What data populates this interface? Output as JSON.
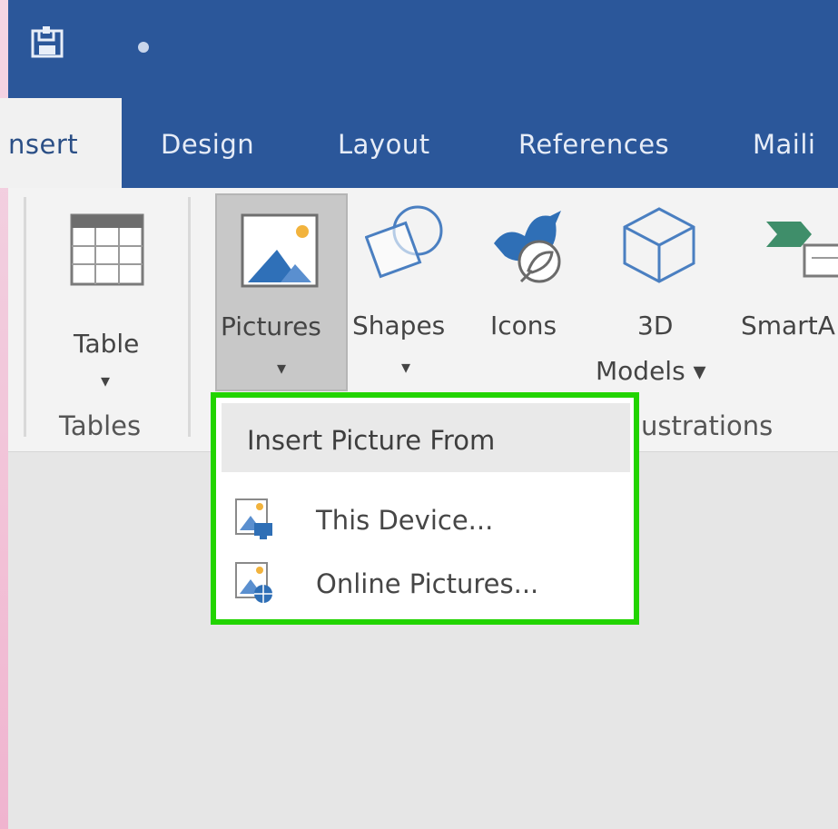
{
  "window": {
    "qat_icons": [
      "save-icon",
      "customize-dot-icon"
    ]
  },
  "tabs": [
    {
      "label": "nsert",
      "active": true
    },
    {
      "label": "Design",
      "active": false
    },
    {
      "label": "Layout",
      "active": false
    },
    {
      "label": "References",
      "active": false
    },
    {
      "label": "Maili",
      "active": false
    }
  ],
  "ribbon": {
    "table": {
      "label": "Table",
      "arrow": "▾",
      "icon": "table-icon"
    },
    "pictures": {
      "label": "Pictures",
      "arrow": "▾",
      "icon": "picture-icon"
    },
    "shapes": {
      "label": "Shapes",
      "arrow": "▾",
      "icon": "shapes-icon"
    },
    "icons": {
      "label": "Icons",
      "icon": "icons-icon"
    },
    "models3d": {
      "label_line1": "3D",
      "label_line2": "Models ▾",
      "icon": "cube-icon"
    },
    "smartart": {
      "label": "SmartA",
      "icon": "smartart-icon"
    },
    "groups": {
      "tables": "Tables",
      "illustrations": "ustrations"
    }
  },
  "dropdown": {
    "header": "Insert Picture From",
    "items": [
      {
        "label": "This Device...",
        "icon": "device-picture-icon"
      },
      {
        "label": "Online Pictures...",
        "icon": "online-picture-icon"
      }
    ],
    "highlight_color": "#22d400"
  },
  "colors": {
    "title_bar": "#2b579a",
    "ribbon_bg": "#f3f3f3",
    "workspace_bg": "#e6e6e6"
  }
}
